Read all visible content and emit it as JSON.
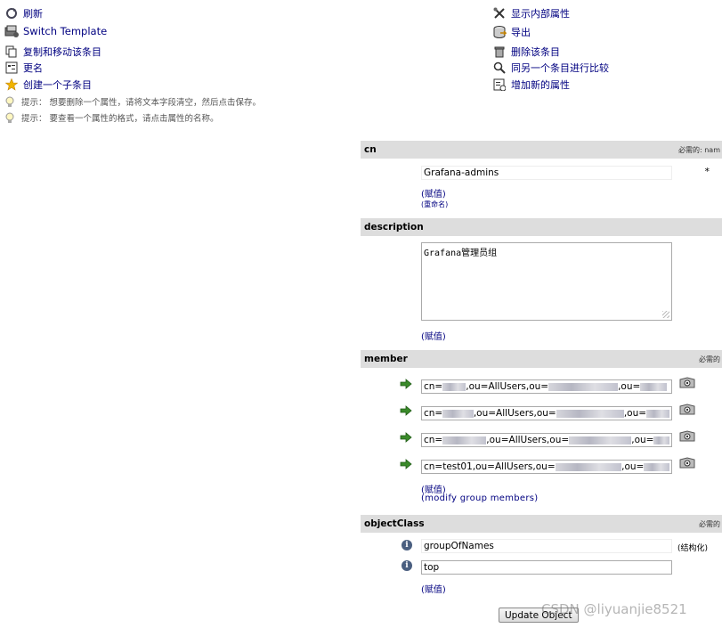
{
  "left_menu": {
    "refresh": "刷新",
    "switch_template": "Switch Template",
    "copy_move": "复制和移动该条目",
    "rename": "更名",
    "create_child": "创建一个子条目"
  },
  "right_menu": {
    "show_internal": "显示内部属性",
    "export": "导出",
    "delete": "删除该条目",
    "compare": "同另一个条目进行比较",
    "add_attr": "增加新的属性"
  },
  "hints": [
    "提示：  想要删除一个属性，请将文本字段清空，然后点击保存。",
    "提示：  要查看一个属性的格式，请点击属性的名称。"
  ],
  "attributes": {
    "cn": {
      "name": "cn",
      "required": "必需的: nam",
      "value": "Grafana-admins",
      "star": "*",
      "add_value": "(赋值)",
      "rename": "(重命名)"
    },
    "description": {
      "name": "description",
      "value": "Grafana管理员组",
      "add_value": "(赋值)"
    },
    "member": {
      "name": "member",
      "required": "必需的",
      "values": [
        {
          "pre": "cn=",
          "mid": ",ou=AllUsers,ou=",
          "post": ",ou="
        },
        {
          "pre": "cn=",
          "mid": ",ou=AllUsers,ou=",
          "post": ",ou="
        },
        {
          "pre": "cn=",
          "mid": ",ou=AllUsers,ou=",
          "post": ",ou="
        },
        {
          "pre": "cn=test01",
          "mid": ",ou=AllUsers,ou=",
          "post": ",ou="
        }
      ],
      "add_value": "(赋值)",
      "modify_group": "(modify group members)"
    },
    "objectClass": {
      "name": "objectClass",
      "required": "必需的",
      "values": [
        "groupOfNames",
        "top"
      ],
      "structural": "(结构化)",
      "add_value": "(赋值)"
    }
  },
  "update_button": "Update Object",
  "watermark": "CSDN @liyuanjie8521"
}
